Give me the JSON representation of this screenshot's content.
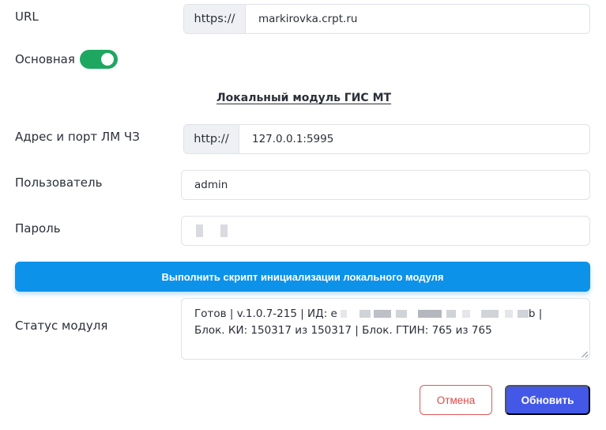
{
  "url_row": {
    "label": "URL",
    "prefix": "https://",
    "value": "markirovka.crpt.ru"
  },
  "main_toggle": {
    "label": "Основная",
    "on": true,
    "color": "#1ea761"
  },
  "section_title": "Локальный модуль ГИС МТ",
  "lm_address": {
    "label": "Адрес и порт ЛМ ЧЗ",
    "prefix": "http://",
    "value": "127.0.0.1:5995"
  },
  "user": {
    "label": "Пользователь",
    "value": "admin"
  },
  "password": {
    "label": "Пароль"
  },
  "run_script_button": {
    "label": "Выполнить скрипт инициализации локального модуля",
    "color": "#0d92ea"
  },
  "status": {
    "label": "Статус модуля",
    "line1_start": "Готов | v.1.0.7-215 | ИД: е",
    "line1_end": "b |",
    "line2": "Блок. КИ: 150317 из 150317 | Блок. ГТИН: 765 из 765"
  },
  "actions": {
    "cancel_label": "Отмена",
    "update_label": "Обновить",
    "cancel_color": "#e04848",
    "update_color": "#4458e8"
  }
}
